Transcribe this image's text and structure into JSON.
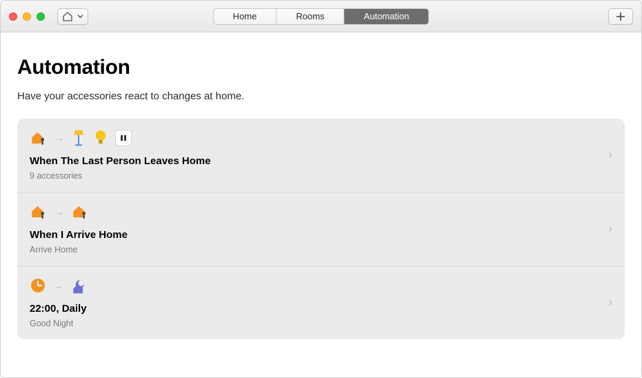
{
  "tabs": {
    "home": "Home",
    "rooms": "Rooms",
    "automation": "Automation",
    "activeIndex": 2
  },
  "page": {
    "title": "Automation",
    "subtitle": "Have your accessories react to changes at home."
  },
  "automations": [
    {
      "title": "When The Last Person Leaves Home",
      "subtitle": "9 accessories",
      "triggerIcon": "house-leave",
      "resultIcons": [
        "lamp",
        "bulb",
        "pause-tile"
      ]
    },
    {
      "title": "When I Arrive Home",
      "subtitle": "Arrive Home",
      "triggerIcon": "house-leave",
      "resultIcons": [
        "house-leave"
      ]
    },
    {
      "title": "22:00, Daily",
      "subtitle": "Good Night",
      "triggerIcon": "clock",
      "resultIcons": [
        "moon-house"
      ]
    }
  ]
}
